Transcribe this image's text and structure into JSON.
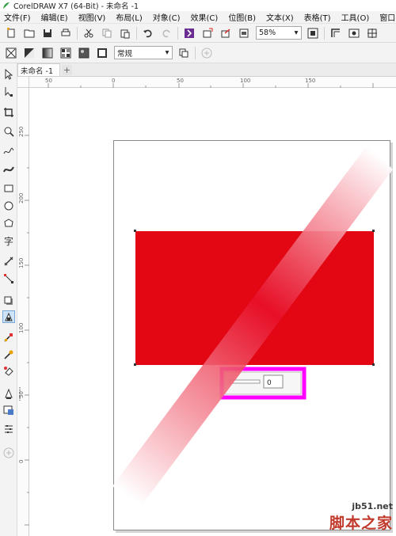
{
  "window": {
    "title": "CorelDRAW X7 (64-Bit) - 未命名 -1"
  },
  "menubar": {
    "items": [
      "文件(F)",
      "编辑(E)",
      "视图(V)",
      "布局(L)",
      "对象(C)",
      "效果(C)",
      "位图(B)",
      "文本(X)",
      "表格(T)",
      "工具(O)",
      "窗口(W)"
    ]
  },
  "toolbar": {
    "zoom_value": "58%",
    "icons": [
      "new-icon",
      "open-icon",
      "save-icon",
      "print-icon",
      "cut-icon",
      "copy-icon",
      "paste-icon",
      "undo-icon",
      "redo-icon",
      "corel-connect-icon",
      "import-icon",
      "export-icon",
      "publish-pdf-icon",
      "zoom-icon",
      "full-screen-icon",
      "view-icon",
      "snap-icon"
    ]
  },
  "property_bar": {
    "mode_value": "常规",
    "icons": [
      "no-transparency-icon",
      "uniform-transparency-icon",
      "fountain-transparency-icon",
      "pattern-transparency-icon",
      "bitmap-transparency-icon",
      "texture-transparency-icon",
      "copy-transparency-icon",
      "add-icon"
    ]
  },
  "document": {
    "tab_label": "未命名 -1",
    "add_tab": "+"
  },
  "rulers": {
    "horizontal": [
      "50",
      "0",
      "50",
      "100",
      "150"
    ],
    "vertical": [
      "250",
      "200",
      "150",
      "100",
      "50",
      "0"
    ]
  },
  "toolbox": {
    "items": [
      "pick-tool-icon",
      "shape-tool-icon",
      "crop-tool-icon",
      "zoom-tool-icon",
      "freehand-tool-icon",
      "artistic-media-tool-icon",
      "rectangle-tool-icon",
      "ellipse-tool-icon",
      "polygon-tool-icon",
      "text-tool-icon",
      "parallel-dimension-tool-icon",
      "connector-tool-icon",
      "drop-shadow-tool-icon",
      "transparency-tool-icon",
      "color-eyedropper-tool-icon",
      "interactive-fill-tool-icon",
      "smart-fill-tool-icon",
      "outline-pen-tool-icon",
      "fill-tool-icon",
      "object-properties-icon",
      "add-tool-icon"
    ]
  },
  "canvas_objects": {
    "rectangle_color": "#e30613",
    "gradient_band_colors": [
      "#e8102a",
      "#ffffff"
    ],
    "transparency_slider_value": "0",
    "highlight_color": "#ff00ff"
  },
  "watermark": {
    "url": "jb51.net",
    "name": "脚本之家"
  }
}
